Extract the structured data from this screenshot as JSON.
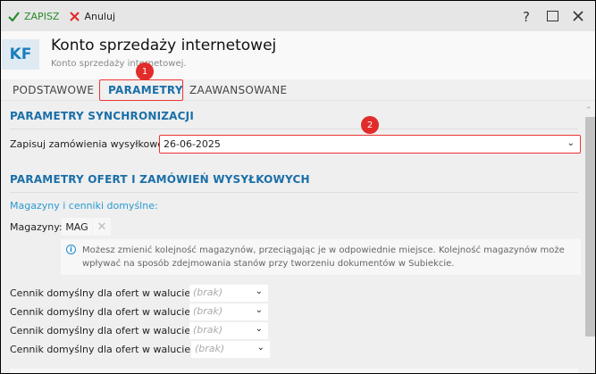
{
  "toolbar": {
    "save_label": "ZAPISZ",
    "cancel_label": "Anuluj",
    "help": "?"
  },
  "header": {
    "badge": "KF",
    "title": "Konto sprzedaży internetowej",
    "subtitle": "Konto sprzedaży internetowej."
  },
  "tabs": [
    {
      "label": "PODSTAWOWE"
    },
    {
      "label": "PARAMETRY",
      "active": true
    },
    {
      "label": "ZAAWANSOWANE"
    }
  ],
  "markers": [
    "1",
    "2"
  ],
  "sync": {
    "title": "PARAMETRY SYNCHRONIZACJI",
    "date_label": "Zapisuj zamówienia wysyłkowe od:",
    "date_value": "26-06-2025"
  },
  "offers": {
    "title": "PARAMETRY OFERT I ZAMÓWIEŃ WYSYŁKOWYCH",
    "subtitle": "Magazyny i cenniki domyślne:",
    "warehouses_label": "Magazyny:",
    "warehouses": [
      "MAG"
    ],
    "info": "Możesz zmienić kolejność magazynów, przeciągając je w odpowiednie miejsce. Kolejność magazynów może wpływać na sposób zdejmowania stanów przy tworzeniu dokumentów w Subiekcie.",
    "pricelists": [
      {
        "label": "Cennik domyślny dla ofert w walucie PLN:",
        "value": "(brak)"
      },
      {
        "label": "Cennik domyślny dla ofert w walucie CZK:",
        "value": "(brak)"
      },
      {
        "label": "Cennik domyślny dla ofert w walucie EUR:",
        "value": "(brak)"
      },
      {
        "label": "Cennik domyślny dla ofert w walucie HUF:",
        "value": "(brak)"
      }
    ]
  },
  "colors": {
    "accent": "#1a6fa8",
    "highlight": "#e33333",
    "save": "#2a8a2a"
  }
}
